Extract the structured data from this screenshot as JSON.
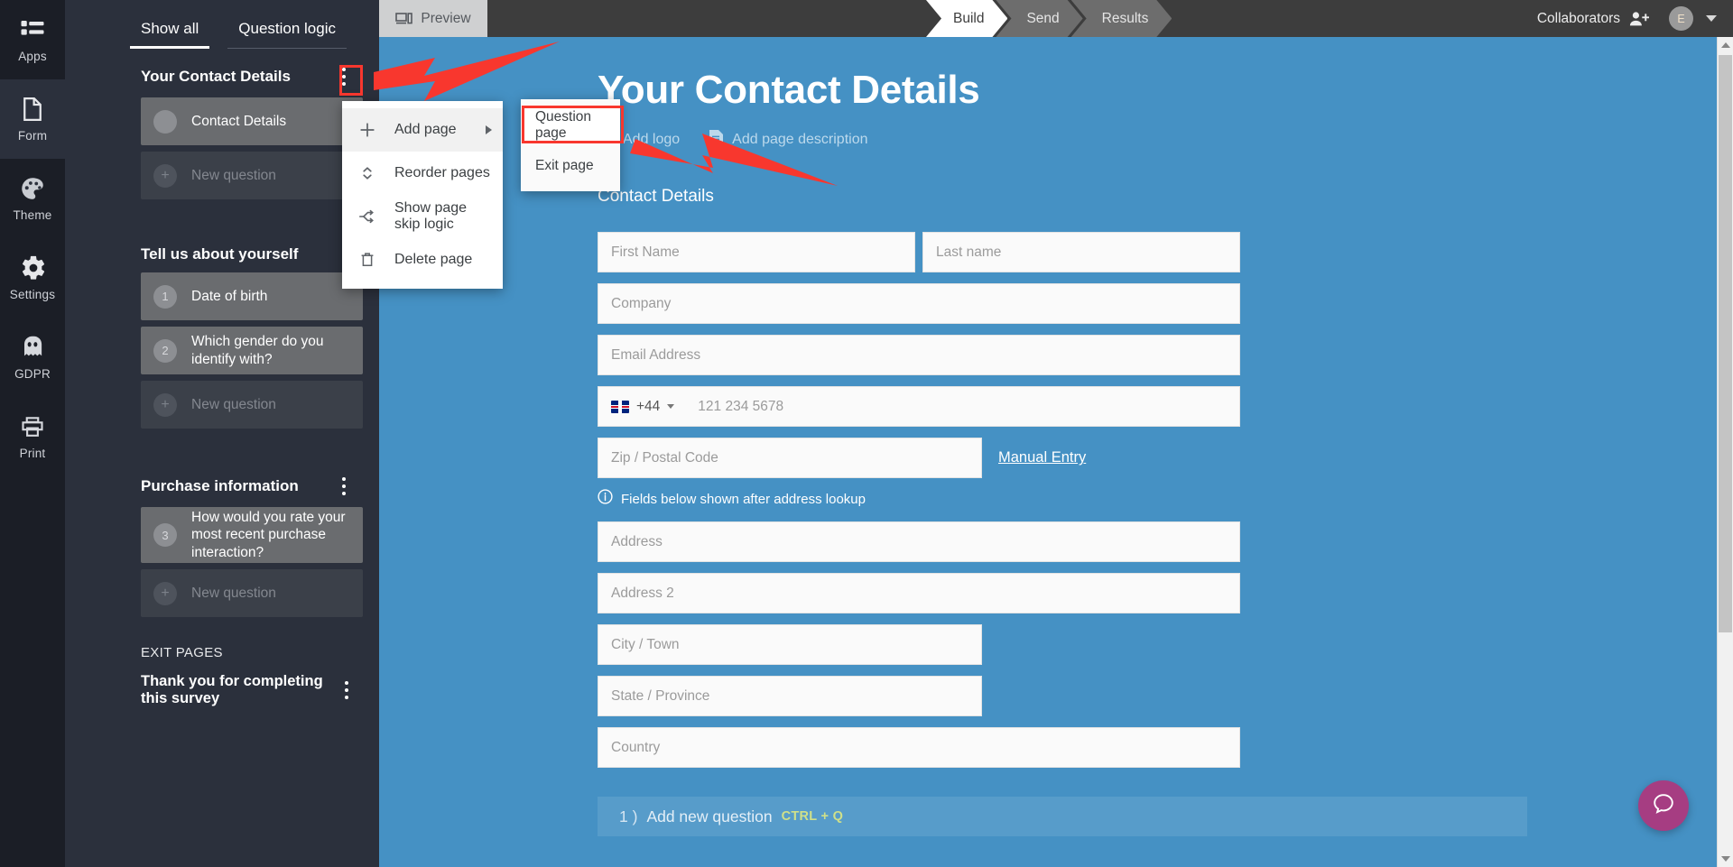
{
  "rail": {
    "items": [
      {
        "label": "Apps",
        "icon": "apps-grid-icon",
        "active": false
      },
      {
        "label": "Form",
        "icon": "document-icon",
        "active": true
      },
      {
        "label": "Theme",
        "icon": "palette-icon",
        "active": false
      },
      {
        "label": "Settings",
        "icon": "gear-icon",
        "active": false
      },
      {
        "label": "GDPR",
        "icon": "ghost-icon",
        "active": false
      },
      {
        "label": "Print",
        "icon": "printer-icon",
        "active": false
      }
    ]
  },
  "panel": {
    "tabs": [
      {
        "label": "Show all",
        "active": true
      },
      {
        "label": "Question logic",
        "active": false
      }
    ],
    "sections": [
      {
        "title": "Your Contact Details",
        "has_kebab": true,
        "rows": [
          {
            "badge": "",
            "label": "Contact Details",
            "state": "selected"
          },
          {
            "badge": "+",
            "label": "New question",
            "state": "add"
          }
        ]
      },
      {
        "title": "Tell us about yourself",
        "has_kebab": false,
        "rows": [
          {
            "badge": "1",
            "label": "Date of birth",
            "state": "selected"
          },
          {
            "badge": "2",
            "label": "Which gender do you identify with?",
            "state": "selected"
          },
          {
            "badge": "+",
            "label": "New question",
            "state": "add"
          }
        ]
      },
      {
        "title": "Purchase information",
        "has_kebab": true,
        "rows": [
          {
            "badge": "3",
            "label": "How would you rate your most recent purchase interaction?",
            "state": "selected"
          },
          {
            "badge": "+",
            "label": "New question",
            "state": "add"
          }
        ]
      }
    ],
    "exit": {
      "heading": "EXIT PAGES",
      "items": [
        {
          "label": "Thank you for completing this survey"
        }
      ]
    }
  },
  "topbar": {
    "preview_label": "Preview",
    "steps": [
      {
        "label": "Build",
        "active": true
      },
      {
        "label": "Send",
        "active": false
      },
      {
        "label": "Results",
        "active": false
      }
    ],
    "collaborators_label": "Collaborators",
    "avatar_initial": "E"
  },
  "menu": {
    "items": [
      {
        "label": "Add page",
        "icon": "plus-icon",
        "has_submenu": true,
        "highlighted": true
      },
      {
        "label": "Reorder pages",
        "icon": "updown-arrows-icon",
        "has_submenu": false,
        "highlighted": false
      },
      {
        "label": "Show page skip logic",
        "icon": "skip-logic-icon",
        "has_submenu": false,
        "highlighted": false
      },
      {
        "label": "Delete page",
        "icon": "trash-icon",
        "has_submenu": false,
        "highlighted": false
      }
    ],
    "submenu": [
      {
        "label": "Question page",
        "highlighted": true
      },
      {
        "label": "Exit page",
        "highlighted": false
      }
    ]
  },
  "form": {
    "title": "Your Contact Details",
    "meta": [
      {
        "label": "Add logo",
        "icon": "image-icon"
      },
      {
        "label": "Add page description",
        "icon": "document-lines-icon"
      }
    ],
    "subheading": "Contact Details",
    "fields": {
      "first_name": "First Name",
      "last_name": "Last name",
      "company": "Company",
      "email": "Email Address",
      "phone_country_code": "+44",
      "phone_placeholder": "121 234 5678",
      "zip": "Zip / Postal Code",
      "manual_entry": "Manual Entry",
      "lookup_note": "Fields below shown after address lookup",
      "address": "Address",
      "address2": "Address 2",
      "city": "City / Town",
      "state": "State / Province",
      "country": "Country"
    },
    "add_question": {
      "number": "1 )",
      "label": "Add new question",
      "shortcut": "CTRL + Q"
    }
  },
  "help": {
    "icon": "chat-bubble-icon"
  },
  "colors": {
    "rail_bg": "#1b1e26",
    "panel_bg": "#2b303c",
    "topbar_bg": "#3d3d3d",
    "canvas_blue": "#4591c4",
    "annotation_red": "#f8372e",
    "help_magenta": "#a63d82",
    "shortcut_green": "#cfe08a"
  }
}
